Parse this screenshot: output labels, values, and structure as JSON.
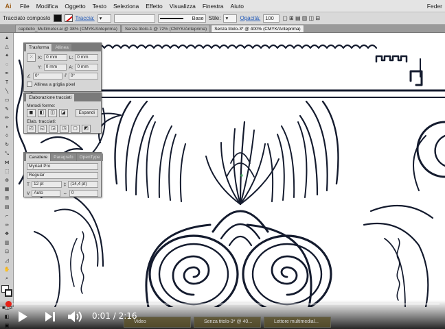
{
  "menubar": {
    "app_icon": "Ai",
    "items": [
      "File",
      "Modifica",
      "Oggetto",
      "Testo",
      "Seleziona",
      "Effetto",
      "Visualizza",
      "Finestra",
      "Aiuto"
    ],
    "user": "Feder"
  },
  "control_bar": {
    "object_type": "Tracciato composto",
    "stroke_label": "Traccia:",
    "stroke_style": "Base",
    "style_label": "Stile:",
    "opacity_label": "Opacità:",
    "opacity_value": "100"
  },
  "doc_tabs": [
    "capitello_Multimeter.ai @ 38% (CMYK/Anteprima)",
    "Senza titolo-1 @ 72% (CMYK/Anteprima)",
    "Senza titolo-3* @ 400% (CMYK/Anteprima)"
  ],
  "panels": {
    "transform": {
      "tabs": [
        "Trasforma",
        "Allinea"
      ],
      "x_label": "X:",
      "x_value": "0 mm",
      "y_label": "Y:",
      "y_value": "0 mm",
      "w_label": "L:",
      "w_value": "0 mm",
      "h_label": "A:",
      "h_value": "0 mm",
      "angle_value": "0°",
      "shear_value": "0°",
      "align_checkbox": "Allinea a griglia pixel"
    },
    "pathfinder": {
      "tab": "Elaborazione tracciati",
      "modes_label": "Metodi forme:",
      "expand_button": "Espandi",
      "paths_label": "Elab. tracciati:"
    },
    "character": {
      "tabs": [
        "Carattere",
        "Paragrafo",
        "OpenType"
      ],
      "font_family": "Myriad Pro",
      "font_style": "Regular",
      "size": "12 pt",
      "leading": "(14,4 pt)",
      "kerning": "Auto",
      "tracking": "0"
    }
  },
  "video": {
    "time": "0:01 / 2:16",
    "progress": 0.007,
    "accent": "#e62117"
  },
  "taskbar": {
    "items": [
      "Video",
      "Senza titolo-3* @ 40...",
      "Lettore multimedial..."
    ]
  }
}
